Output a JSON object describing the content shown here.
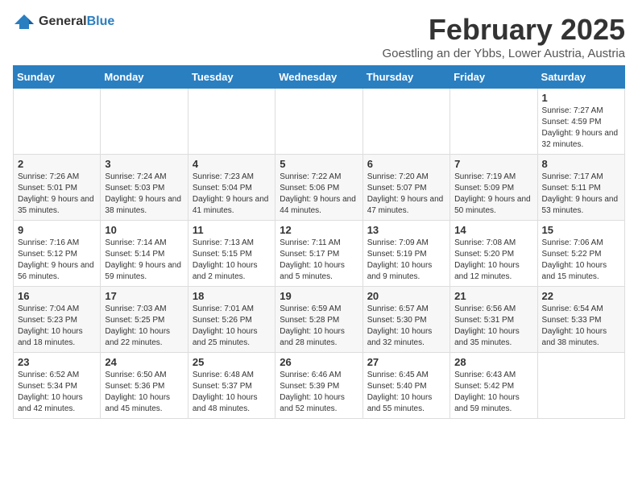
{
  "logo": {
    "general": "General",
    "blue": "Blue"
  },
  "header": {
    "month": "February 2025",
    "location": "Goestling an der Ybbs, Lower Austria, Austria"
  },
  "weekdays": [
    "Sunday",
    "Monday",
    "Tuesday",
    "Wednesday",
    "Thursday",
    "Friday",
    "Saturday"
  ],
  "weeks": [
    [
      {
        "day": "",
        "info": ""
      },
      {
        "day": "",
        "info": ""
      },
      {
        "day": "",
        "info": ""
      },
      {
        "day": "",
        "info": ""
      },
      {
        "day": "",
        "info": ""
      },
      {
        "day": "",
        "info": ""
      },
      {
        "day": "1",
        "info": "Sunrise: 7:27 AM\nSunset: 4:59 PM\nDaylight: 9 hours and 32 minutes."
      }
    ],
    [
      {
        "day": "2",
        "info": "Sunrise: 7:26 AM\nSunset: 5:01 PM\nDaylight: 9 hours and 35 minutes."
      },
      {
        "day": "3",
        "info": "Sunrise: 7:24 AM\nSunset: 5:03 PM\nDaylight: 9 hours and 38 minutes."
      },
      {
        "day": "4",
        "info": "Sunrise: 7:23 AM\nSunset: 5:04 PM\nDaylight: 9 hours and 41 minutes."
      },
      {
        "day": "5",
        "info": "Sunrise: 7:22 AM\nSunset: 5:06 PM\nDaylight: 9 hours and 44 minutes."
      },
      {
        "day": "6",
        "info": "Sunrise: 7:20 AM\nSunset: 5:07 PM\nDaylight: 9 hours and 47 minutes."
      },
      {
        "day": "7",
        "info": "Sunrise: 7:19 AM\nSunset: 5:09 PM\nDaylight: 9 hours and 50 minutes."
      },
      {
        "day": "8",
        "info": "Sunrise: 7:17 AM\nSunset: 5:11 PM\nDaylight: 9 hours and 53 minutes."
      }
    ],
    [
      {
        "day": "9",
        "info": "Sunrise: 7:16 AM\nSunset: 5:12 PM\nDaylight: 9 hours and 56 minutes."
      },
      {
        "day": "10",
        "info": "Sunrise: 7:14 AM\nSunset: 5:14 PM\nDaylight: 9 hours and 59 minutes."
      },
      {
        "day": "11",
        "info": "Sunrise: 7:13 AM\nSunset: 5:15 PM\nDaylight: 10 hours and 2 minutes."
      },
      {
        "day": "12",
        "info": "Sunrise: 7:11 AM\nSunset: 5:17 PM\nDaylight: 10 hours and 5 minutes."
      },
      {
        "day": "13",
        "info": "Sunrise: 7:09 AM\nSunset: 5:19 PM\nDaylight: 10 hours and 9 minutes."
      },
      {
        "day": "14",
        "info": "Sunrise: 7:08 AM\nSunset: 5:20 PM\nDaylight: 10 hours and 12 minutes."
      },
      {
        "day": "15",
        "info": "Sunrise: 7:06 AM\nSunset: 5:22 PM\nDaylight: 10 hours and 15 minutes."
      }
    ],
    [
      {
        "day": "16",
        "info": "Sunrise: 7:04 AM\nSunset: 5:23 PM\nDaylight: 10 hours and 18 minutes."
      },
      {
        "day": "17",
        "info": "Sunrise: 7:03 AM\nSunset: 5:25 PM\nDaylight: 10 hours and 22 minutes."
      },
      {
        "day": "18",
        "info": "Sunrise: 7:01 AM\nSunset: 5:26 PM\nDaylight: 10 hours and 25 minutes."
      },
      {
        "day": "19",
        "info": "Sunrise: 6:59 AM\nSunset: 5:28 PM\nDaylight: 10 hours and 28 minutes."
      },
      {
        "day": "20",
        "info": "Sunrise: 6:57 AM\nSunset: 5:30 PM\nDaylight: 10 hours and 32 minutes."
      },
      {
        "day": "21",
        "info": "Sunrise: 6:56 AM\nSunset: 5:31 PM\nDaylight: 10 hours and 35 minutes."
      },
      {
        "day": "22",
        "info": "Sunrise: 6:54 AM\nSunset: 5:33 PM\nDaylight: 10 hours and 38 minutes."
      }
    ],
    [
      {
        "day": "23",
        "info": "Sunrise: 6:52 AM\nSunset: 5:34 PM\nDaylight: 10 hours and 42 minutes."
      },
      {
        "day": "24",
        "info": "Sunrise: 6:50 AM\nSunset: 5:36 PM\nDaylight: 10 hours and 45 minutes."
      },
      {
        "day": "25",
        "info": "Sunrise: 6:48 AM\nSunset: 5:37 PM\nDaylight: 10 hours and 48 minutes."
      },
      {
        "day": "26",
        "info": "Sunrise: 6:46 AM\nSunset: 5:39 PM\nDaylight: 10 hours and 52 minutes."
      },
      {
        "day": "27",
        "info": "Sunrise: 6:45 AM\nSunset: 5:40 PM\nDaylight: 10 hours and 55 minutes."
      },
      {
        "day": "28",
        "info": "Sunrise: 6:43 AM\nSunset: 5:42 PM\nDaylight: 10 hours and 59 minutes."
      },
      {
        "day": "",
        "info": ""
      }
    ]
  ]
}
